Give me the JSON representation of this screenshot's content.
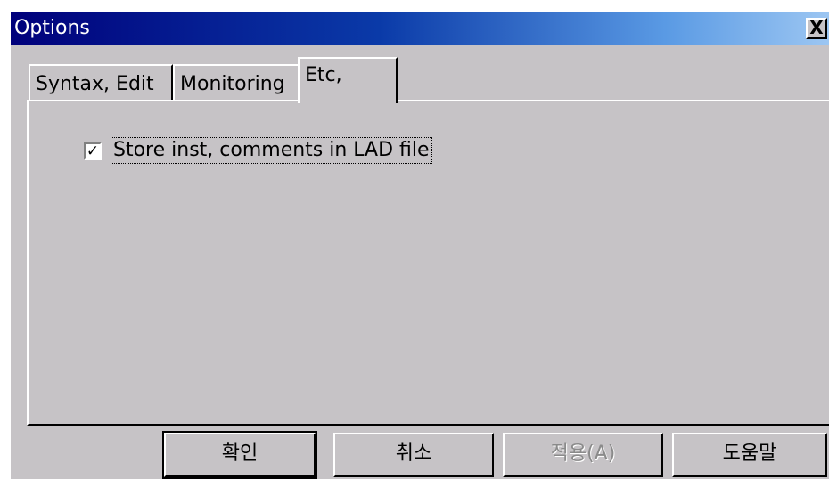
{
  "window": {
    "title": "Options",
    "close_glyph": "X"
  },
  "tabs": [
    {
      "label": "Syntax, Edit",
      "selected": false
    },
    {
      "label": "Monitoring",
      "selected": false
    },
    {
      "label": "Etc,",
      "selected": true
    }
  ],
  "panel": {
    "store_comments": {
      "checked": true,
      "glyph": "✓",
      "label": "Store inst, comments in LAD file"
    }
  },
  "buttons": {
    "ok": "확인",
    "cancel": "취소",
    "apply": "적용(A)",
    "help": "도움말"
  },
  "colors": {
    "face": "#c6c3c6",
    "title_start": "#00007b",
    "title_end": "#9cc6f2"
  }
}
